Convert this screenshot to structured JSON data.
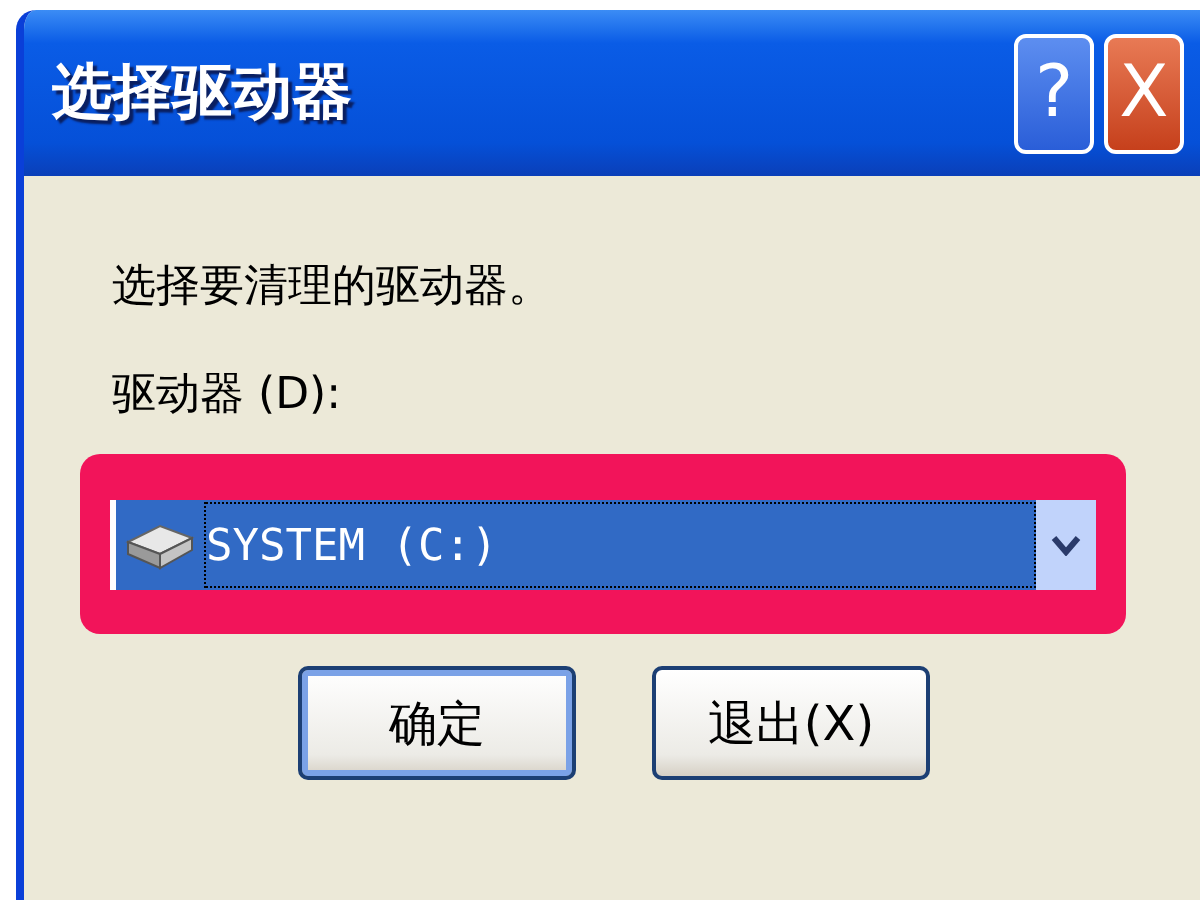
{
  "window": {
    "title": "选择驱动器",
    "title_buttons": [
      {
        "kind": "help",
        "label": "?"
      },
      {
        "kind": "close",
        "label": "X"
      }
    ]
  },
  "prompt": "选择要清理的驱动器。",
  "drive_label": "驱动器 (D):",
  "drive_select": {
    "value": "SYSTEM (C:)"
  },
  "buttons": [
    {
      "label": "确定",
      "default": true
    },
    {
      "label": "退出(X)",
      "default": false
    }
  ]
}
